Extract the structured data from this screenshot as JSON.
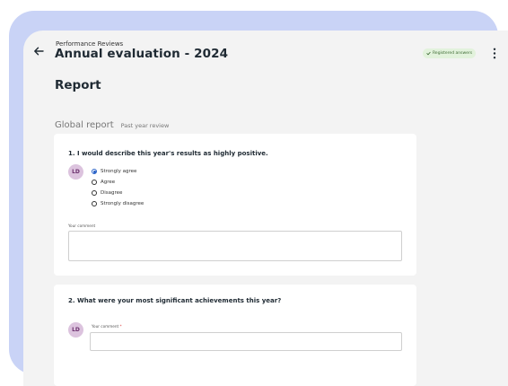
{
  "header": {
    "breadcrumb": "Performance Reviews",
    "title": "Annual evaluation - 2024",
    "status_badge": "Registered answers",
    "back_icon": "arrow-left-icon",
    "more_icon": "more-vertical-icon"
  },
  "section": {
    "title": "Report"
  },
  "report": {
    "title": "Global report",
    "subtitle": "Past year review"
  },
  "questions": [
    {
      "label": "1. I would describe this year's results as highly positive.",
      "avatar_initials": "LD",
      "options": [
        "Strongly agree",
        "Agree",
        "Disagree",
        "Strongly disagree"
      ],
      "selected": "Strongly agree",
      "comment_label": "Your comment",
      "comment_value": ""
    },
    {
      "label": "2. What were your most significant achievements this year?",
      "avatar_initials": "LD",
      "comment_label": "Your comment",
      "comment_required_marker": "*",
      "comment_value": ""
    }
  ],
  "colors": {
    "backdrop_blue": "#c9d3f6",
    "panel": "#f3f3f3",
    "accent": "#2a63c8",
    "badge_bg": "#e2f2dc",
    "badge_text": "#3d6a33",
    "avatar_bg": "#dcc3de"
  }
}
